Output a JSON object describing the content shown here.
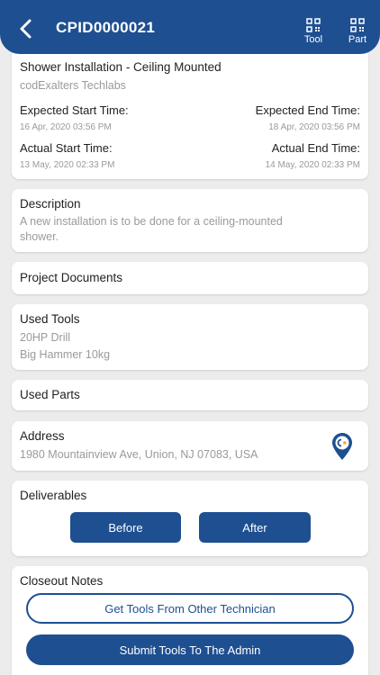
{
  "header": {
    "title": "CPID0000021",
    "back_icon": "back-chevron-icon",
    "tool_label": "Tool",
    "part_label": "Part",
    "qr_icon": "qr-code-icon",
    "bg_color": "#1e4f91"
  },
  "project": {
    "name": "Shower Installation - Ceiling Mounted",
    "company": "codExalters Techlabs",
    "expected_start_label": "Expected Start Time:",
    "expected_start_value": "16 Apr, 2020 03:56 PM",
    "expected_end_label": "Expected End Time:",
    "expected_end_value": "18 Apr, 2020 03:56 PM",
    "actual_start_label": "Actual Start Time:",
    "actual_start_value": "13 May, 2020 02:33 PM",
    "actual_end_label": "Actual End Time:",
    "actual_end_value": "14 May, 2020 02:33 PM"
  },
  "description": {
    "title": "Description",
    "line1": "A new installation is to be done for a ceiling-mounted",
    "line2": "shower."
  },
  "documents": {
    "title": "Project Documents"
  },
  "tools": {
    "title": "Used Tools",
    "items": [
      "20HP Drill",
      "Big Hammer 10kg"
    ]
  },
  "parts": {
    "title": "Used Parts"
  },
  "address": {
    "title": "Address",
    "value": "1980 Mountainview Ave, Union, NJ 07083, USA",
    "icon": "map-pin-icon"
  },
  "deliverables": {
    "title": "Deliverables",
    "before_label": "Before",
    "after_label": "After"
  },
  "closeout": {
    "title": "Closeout Notes",
    "get_tools_label": "Get Tools From Other Technician",
    "submit_tools_label": "Submit Tools To The Admin"
  }
}
